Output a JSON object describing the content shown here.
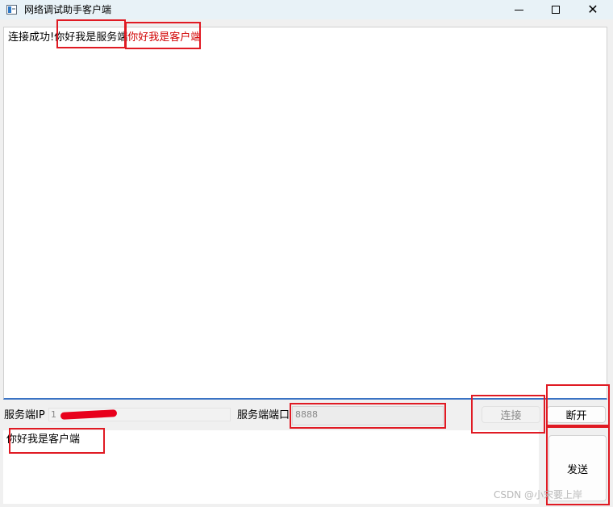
{
  "window": {
    "title": "网络调试助手客户端",
    "icons": {
      "app": "window-app-icon",
      "minimize": "minimize-icon",
      "maximize": "maximize-icon",
      "close": "close-icon"
    }
  },
  "receive": {
    "prefix": "连接成功!",
    "server_message": "你好我是服务端",
    "client_message": "你好我是客户端"
  },
  "controls": {
    "ip_label": "服务端IP",
    "ip_value_visible": "1",
    "port_label": "服务端端口",
    "port_value": "8888",
    "connect_label": "连接",
    "disconnect_label": "断开"
  },
  "send": {
    "text": "你好我是客户端",
    "button_label": "发送"
  },
  "watermark": "CSDN @小宋要上岸",
  "colors": {
    "client_message": "#d10000",
    "highlight_box": "#e01a23",
    "title_bar": "#e8f2f7",
    "focus_border": "#3a73c4"
  }
}
